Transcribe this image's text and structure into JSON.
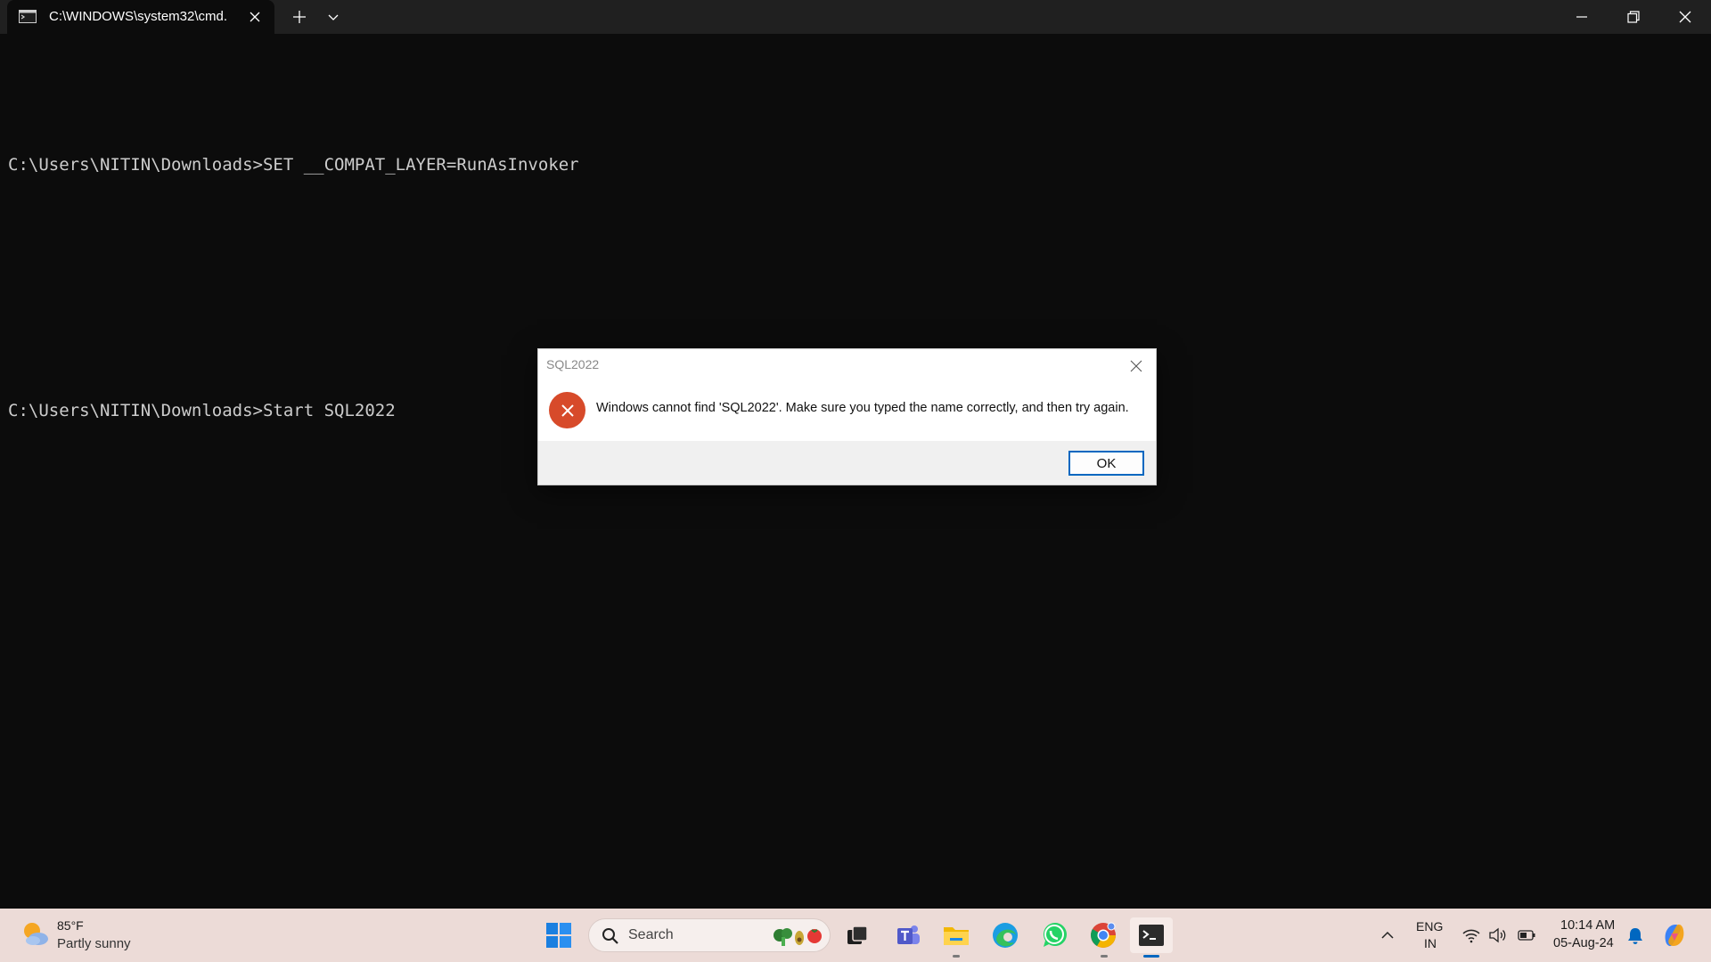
{
  "window": {
    "tab_title": "C:\\WINDOWS\\system32\\cmd.",
    "tab_icon": "cmd-icon",
    "controls": [
      "minimize-icon",
      "restore-icon",
      "close-icon"
    ]
  },
  "console": {
    "lines": [
      "C:\\Users\\NITIN\\Downloads>SET __COMPAT_LAYER=RunAsInvoker",
      "",
      "C:\\Users\\NITIN\\Downloads>Start SQL2022"
    ]
  },
  "dialog": {
    "title": "SQL2022",
    "message": "Windows cannot find 'SQL2022'. Make sure you typed the name correctly, and then try again.",
    "ok_label": "OK",
    "icon": "error-icon"
  },
  "taskbar": {
    "weather_temp": "85°F",
    "weather_desc": "Partly sunny",
    "search_label": "Search",
    "apps": [
      "start-icon",
      "task-view-icon",
      "teams-icon",
      "file-explorer-icon",
      "edge-icon",
      "whatsapp-icon",
      "chrome-icon",
      "terminal-icon"
    ],
    "lang_line1": "ENG",
    "lang_line2": "IN",
    "time": "10:14 AM",
    "date": "05-Aug-24"
  },
  "colors": {
    "console_bg": "#0c0c0c",
    "titlebar_bg": "#202020",
    "error_red": "#d74a2a",
    "accent": "#0067c0",
    "taskbar_bg": "#ecdbd7"
  }
}
